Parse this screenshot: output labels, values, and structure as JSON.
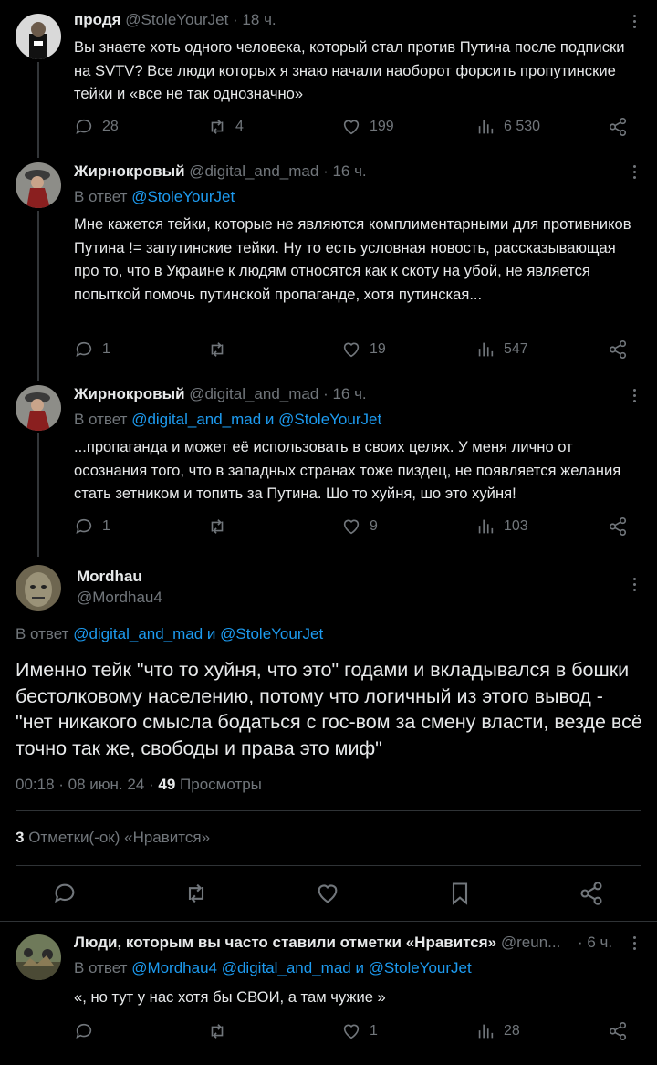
{
  "posts": [
    {
      "name": "продя",
      "handle": "@StoleYourJet",
      "time": "· 18 ч.",
      "text": "Вы знаете хоть одного человека, который стал против Путина после подписки на SVTV? Все люди которых я знаю начали наоборот форсить пропутинские тейки и «все не так однозначно»",
      "replies": "28",
      "reposts": "4",
      "likes": "199",
      "views": "6 530"
    },
    {
      "name": "Жирнокровый",
      "handle": "@digital_and_mad",
      "time": "· 16 ч.",
      "reply_prefix": "В ответ",
      "reply_mentions": "@StoleYourJet",
      "text": "Мне кажется тейки, которые не являются комплиментарными для противников Путина != запутинские тейки. Ну то есть условная новость, рассказывающая про то, что в Украине к людям относятся как к скоту на убой, не является попыткой помочь путинской пропаганде, хотя путинская...",
      "replies": "1",
      "reposts": "",
      "likes": "19",
      "views": "547"
    },
    {
      "name": "Жирнокровый",
      "handle": "@digital_and_mad",
      "time": "· 16 ч.",
      "reply_prefix": "В ответ",
      "reply_mentions": "@digital_and_mad и @StoleYourJet",
      "text": "...пропаганда и может её использовать в своих целях. У меня лично от осознания того, что в западных странах тоже пиздец, не появляется желания стать зетником и топить за Путина. Шо то хуйня, шо это хуйня!",
      "replies": "1",
      "reposts": "",
      "likes": "9",
      "views": "103"
    }
  ],
  "main_post": {
    "name": "Mordhau",
    "handle": "@Mordhau4",
    "reply_prefix": "В ответ",
    "reply_mentions": "@digital_and_mad и @StoleYourJet",
    "text": "Именно тейк \"что то хуйня, что это\" годами и вкладывался в бошки бестолковому населению, потому что логичный из этого вывод - \"нет никакого смысла бодаться с гос-вом за смену власти, везде всё точно так же, свободы и права это миф\"",
    "timestamp": "00:18 · 08 июн. 24 ·",
    "views_count": "49",
    "views_label": "Просмотры",
    "likes_count": "3",
    "likes_label": "Отметки(-ок) «Нравится»"
  },
  "bottom_post": {
    "name": "Люди, которым вы часто ставили отметки «Нравится»",
    "handle": "@reun...",
    "time": "· 6 ч.",
    "reply_prefix": "В ответ",
    "reply_mentions": "@Mordhau4 @digital_and_mad и @StoleYourJet",
    "text": "«, но тут у нас хотя бы СВОИ, а там чужие »",
    "replies": "",
    "reposts": "",
    "likes": "1",
    "views": "28"
  },
  "colors": {
    "accent": "#1d9bf0",
    "muted": "#71767b",
    "text": "#e7e9ea",
    "background": "#000000"
  },
  "icons": [
    "reply-icon",
    "repost-icon",
    "like-icon",
    "views-icon",
    "share-icon",
    "bookmark-icon",
    "more-icon"
  ]
}
